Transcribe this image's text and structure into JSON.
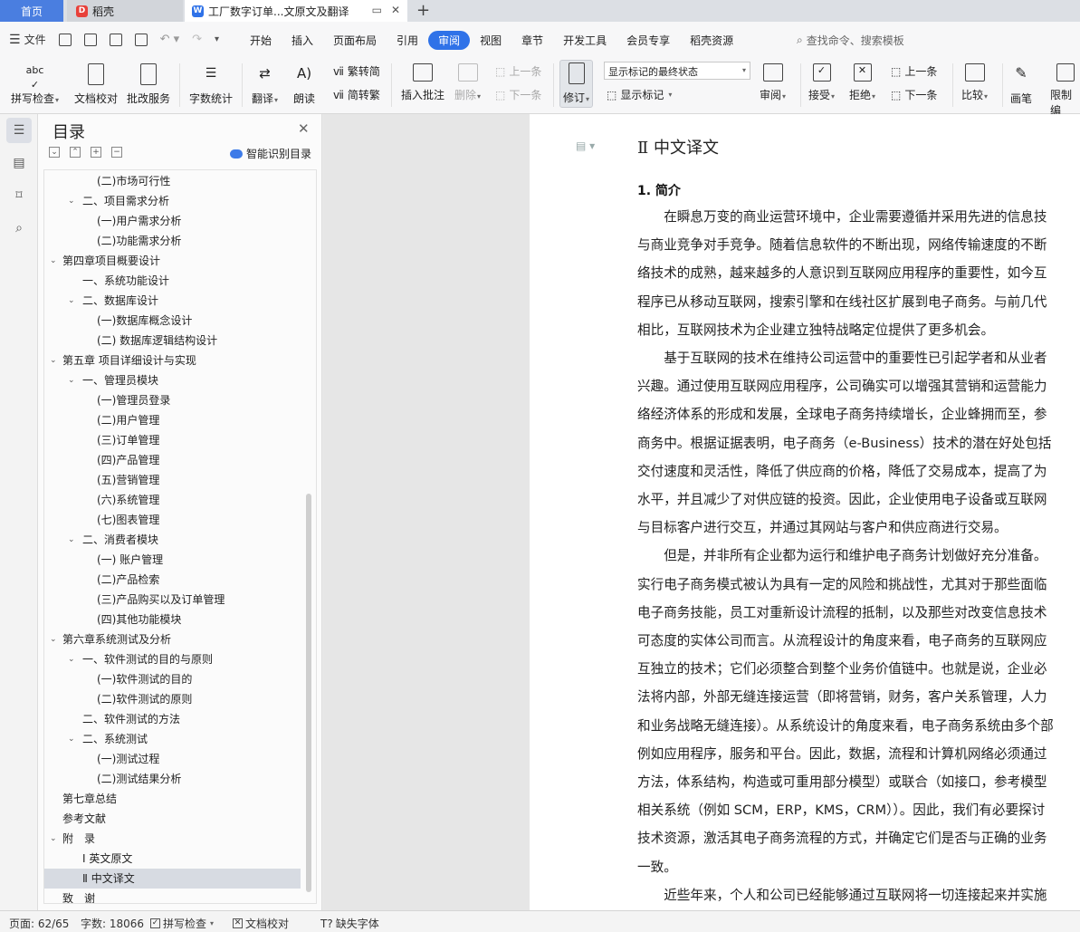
{
  "tabs": {
    "home": "首页",
    "daoke": "稻壳",
    "document": "工厂数字订单...文原文及翻译",
    "new_tab": "+"
  },
  "menubar": {
    "file": "文件",
    "tabs": [
      "开始",
      "插入",
      "页面布局",
      "引用",
      "审阅",
      "视图",
      "章节",
      "开发工具",
      "会员专享",
      "稻壳资源"
    ],
    "active_tab": "审阅",
    "search": "查找命令、搜索模板"
  },
  "ribbon": {
    "spell_check": "拼写检查",
    "doc_proof": "文档校对",
    "batch_service": "批改服务",
    "word_count": "字数统计",
    "translate": "翻译",
    "read_aloud": "朗读",
    "trad_to_simp": "繁转简",
    "simp_to_trad": "简转繁",
    "insert_comment": "插入批注",
    "delete": "删除",
    "prev_comment": "上一条",
    "next_comment": "下一条",
    "track_changes": "修订",
    "display_mode": "显示标记的最终状态",
    "show_markup": "显示标记",
    "review": "审阅",
    "accept": "接受",
    "reject": "拒绝",
    "prev_change": "上一条",
    "next_change": "下一条",
    "compare": "比较",
    "pen": "画笔",
    "restrict_edit": "限制编"
  },
  "toc": {
    "title": "目录",
    "smart_toc": "智能识别目录",
    "items": [
      {
        "label": "(二)市场可行性",
        "level": 3,
        "arrow": ""
      },
      {
        "label": "二、项目需求分析",
        "level": 2,
        "arrow": "v"
      },
      {
        "label": "(一)用户需求分析",
        "level": 3,
        "arrow": ""
      },
      {
        "label": "(二)功能需求分析",
        "level": 3,
        "arrow": ""
      },
      {
        "label": "第四章项目概要设计",
        "level": 1,
        "arrow": "v"
      },
      {
        "label": "一、系统功能设计",
        "level": 2,
        "arrow": ""
      },
      {
        "label": "二、数据库设计",
        "level": 2,
        "arrow": "v"
      },
      {
        "label": "(一)数据库概念设计",
        "level": 3,
        "arrow": ""
      },
      {
        "label": "(二) 数据库逻辑结构设计",
        "level": 3,
        "arrow": ""
      },
      {
        "label": "第五章 项目详细设计与实现",
        "level": 1,
        "arrow": "v"
      },
      {
        "label": "一、管理员模块",
        "level": 2,
        "arrow": "v"
      },
      {
        "label": "(一)管理员登录",
        "level": 3,
        "arrow": ""
      },
      {
        "label": "(二)用户管理",
        "level": 3,
        "arrow": ""
      },
      {
        "label": "(三)订单管理",
        "level": 3,
        "arrow": ""
      },
      {
        "label": "(四)产品管理",
        "level": 3,
        "arrow": ""
      },
      {
        "label": "(五)营销管理",
        "level": 3,
        "arrow": ""
      },
      {
        "label": "(六)系统管理",
        "level": 3,
        "arrow": ""
      },
      {
        "label": "(七)图表管理",
        "level": 3,
        "arrow": ""
      },
      {
        "label": "二、消费者模块",
        "level": 2,
        "arrow": "v"
      },
      {
        "label": "(一) 账户管理",
        "level": 3,
        "arrow": ""
      },
      {
        "label": "(二)产品检索",
        "level": 3,
        "arrow": ""
      },
      {
        "label": "(三)产品购买以及订单管理",
        "level": 3,
        "arrow": ""
      },
      {
        "label": "(四)其他功能模块",
        "level": 3,
        "arrow": ""
      },
      {
        "label": "第六章系统测试及分析",
        "level": 1,
        "arrow": "v"
      },
      {
        "label": "一、软件测试的目的与原则",
        "level": 2,
        "arrow": "v"
      },
      {
        "label": "(一)软件测试的目的",
        "level": 3,
        "arrow": ""
      },
      {
        "label": "(二)软件测试的原则",
        "level": 3,
        "arrow": ""
      },
      {
        "label": "二、软件测试的方法",
        "level": 2,
        "arrow": ""
      },
      {
        "label": "二、系统测试",
        "level": 2,
        "arrow": "v"
      },
      {
        "label": "(一)测试过程",
        "level": 3,
        "arrow": ""
      },
      {
        "label": "(二)测试结果分析",
        "level": 3,
        "arrow": ""
      },
      {
        "label": "第七章总结",
        "level": 1,
        "arrow": ""
      },
      {
        "label": "参考文献",
        "level": 1,
        "arrow": ""
      },
      {
        "label": "附　录",
        "level": 1,
        "arrow": "v"
      },
      {
        "label": "Ⅰ 英文原文",
        "level": 2,
        "arrow": ""
      },
      {
        "label": "Ⅱ 中文译文",
        "level": 2,
        "arrow": "",
        "selected": true
      },
      {
        "label": "致　谢",
        "level": 1,
        "arrow": ""
      }
    ]
  },
  "document": {
    "heading": "Ⅱ  中文译文",
    "section_title": "1. 简介",
    "lines": [
      "　　在瞬息万变的商业运营环境中，企业需要遵循并采用先进的信息技",
      "与商业竞争对手竞争。随着信息软件的不断出现，网络传输速度的不断",
      "络技术的成熟，越来越多的人意识到互联网应用程序的重要性，如今互",
      "程序已从移动互联网，搜索引擎和在线社区扩展到电子商务。与前几代",
      "相比，互联网技术为企业建立独特战略定位提供了更多机会。",
      "　　基于互联网的技术在维持公司运营中的重要性已引起学者和从业者",
      "兴趣。通过使用互联网应用程序，公司确实可以增强其营销和运营能力",
      "络经济体系的形成和发展，全球电子商务持续增长，企业蜂拥而至，参",
      "商务中。根据证据表明，电子商务（e-Business）技术的潜在好处包括",
      "交付速度和灵活性，降低了供应商的价格，降低了交易成本，提高了为",
      "水平，并且减少了对供应链的投资。因此，企业使用电子设备或互联网",
      "与目标客户进行交互，并通过其网站与客户和供应商进行交易。",
      "　　但是，并非所有企业都为运行和维护电子商务计划做好充分准备。",
      "实行电子商务模式被认为具有一定的风险和挑战性，尤其对于那些面临",
      "电子商务技能，员工对重新设计流程的抵制，以及那些对改变信息技术",
      "可态度的实体公司而言。从流程设计的角度来看，电子商务的互联网应",
      "互独立的技术；它们必须整合到整个业务价值链中。也就是说，企业必",
      "法将内部，外部无缝连接运营（即将营销，财务，客户关系管理，人力",
      "和业务战略无缝连接）。从系统设计的角度来看，电子商务系统由多个部",
      "例如应用程序，服务和平台。因此，数据，流程和计算机网络必须通过",
      "方法，体系结构，构造或可重用部分模型）或联合（如接口，参考模型",
      "相关系统（例如 SCM，ERP，KMS，CRM））。因此，我们有必要探讨",
      "技术资源，激活其电子商务流程的方式，并确定它们是否与正确的业务",
      "一致。",
      "　　近些年来，个人和公司已经能够通过互联网将一切连接起来并实施"
    ]
  },
  "status": {
    "page": "页面: 62/65",
    "word_count": "字数: 18066",
    "spell_check": "拼写检查",
    "doc_proof": "文档校对",
    "missing_font": "缺失字体"
  }
}
